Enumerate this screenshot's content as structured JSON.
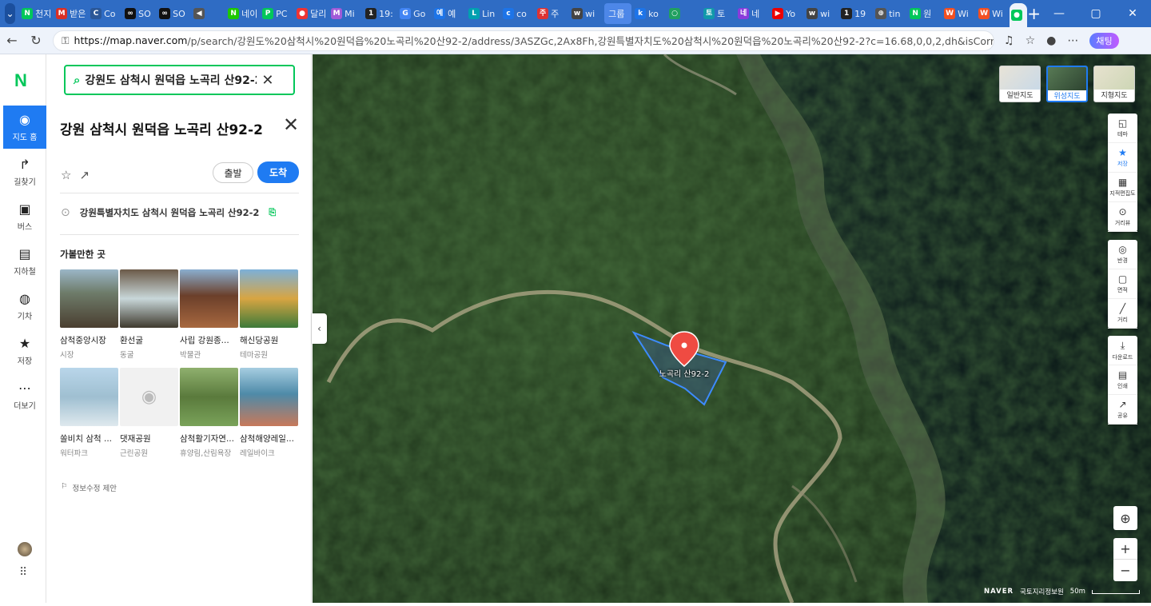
{
  "browser": {
    "tabs": [
      {
        "label": "천지",
        "color": "#03c75a",
        "g": "N"
      },
      {
        "label": "받은",
        "color": "#d93025",
        "g": "M"
      },
      {
        "label": "Co",
        "color": "#2b5797",
        "g": "C"
      },
      {
        "label": "SO",
        "color": "#111",
        "g": "∞"
      },
      {
        "label": "SO",
        "color": "#111",
        "g": "∞"
      },
      {
        "label": "",
        "color": "#555",
        "g": "◀"
      },
      {
        "label": "네이",
        "color": "#1ec800",
        "g": "N"
      },
      {
        "label": "PC",
        "color": "#03c75a",
        "g": "P"
      },
      {
        "label": "달리",
        "color": "#e33",
        "g": "●"
      },
      {
        "label": "Mi",
        "color": "#a15bd8",
        "g": "M"
      },
      {
        "label": "19:",
        "color": "#222",
        "g": "1"
      },
      {
        "label": "Go",
        "color": "#4285f4",
        "g": "G"
      },
      {
        "label": "예",
        "color": "#1d74e8",
        "g": "예"
      },
      {
        "label": "Lin",
        "color": "#00a0b0",
        "g": "L"
      },
      {
        "label": "co",
        "color": "#1d74e8",
        "g": "c"
      },
      {
        "label": "주",
        "color": "#d33",
        "g": "주"
      },
      {
        "label": "wi",
        "color": "#444",
        "g": "w"
      },
      {
        "label": "그룹",
        "color": "#4d87e8",
        "g": ""
      },
      {
        "label": "ko",
        "color": "#1d74e8",
        "g": "k"
      },
      {
        "label": "",
        "color": "#20a060",
        "g": "○"
      },
      {
        "label": "토",
        "color": "#19a",
        "g": "토"
      },
      {
        "label": "네",
        "color": "#8a3bdb",
        "g": "네"
      },
      {
        "label": "Yo",
        "color": "#e00",
        "g": "▶"
      },
      {
        "label": "wi",
        "color": "#444",
        "g": "w"
      },
      {
        "label": "19",
        "color": "#222",
        "g": "1"
      },
      {
        "label": "tin",
        "color": "#555",
        "g": "⊕"
      },
      {
        "label": "원",
        "color": "#03c75a",
        "g": "N"
      },
      {
        "label": "Wi",
        "color": "#f25022",
        "g": "W"
      },
      {
        "label": "Wi",
        "color": "#f25022",
        "g": "W"
      }
    ],
    "active_tab_close": "✕",
    "new_tab": "+",
    "url_host": "https://map.naver.com",
    "url_path": "/p/search/강원도%20삼척시%20원덕읍%20노곡리%20산92-2/address/3ASZGc,2Ax8Fh,강원특별자치도%20삼척시%20원덕읍%20노곡리%20산92-2?c=16.68,0,0,2,dh&isCorrectAnswer=t...",
    "chat_label": "채팅"
  },
  "rail": {
    "logo": "N",
    "items": [
      {
        "label": "지도 홈",
        "icon": "map-home"
      },
      {
        "label": "길찾기",
        "icon": "directions"
      },
      {
        "label": "버스",
        "icon": "bus"
      },
      {
        "label": "지하철",
        "icon": "subway"
      },
      {
        "label": "기차",
        "icon": "train"
      },
      {
        "label": "저장",
        "icon": "star"
      },
      {
        "label": "더보기",
        "icon": "more"
      }
    ]
  },
  "panel": {
    "search_value": "강원도 삼척시 원덕읍 노곡리 산92-2",
    "title": "강원 삼척시 원덕읍 노곡리 산92-2",
    "depart": "출발",
    "arrive": "도착",
    "address": "강원특별자치도 삼척시 원덕읍 노곡리 산92-2",
    "section": "가볼만한 곳",
    "places": [
      {
        "name": "삼척중앙시장",
        "cat": "시장"
      },
      {
        "name": "환선굴",
        "cat": "동굴"
      },
      {
        "name": "사립 강원종...",
        "cat": "박물관"
      },
      {
        "name": "해신당공원",
        "cat": "테마공원"
      },
      {
        "name": "쏠비치 삼척 ...",
        "cat": "워터파크"
      },
      {
        "name": "댓재공원",
        "cat": "근린공원"
      },
      {
        "name": "삼척활기자연...",
        "cat": "휴양림,산림욕장"
      },
      {
        "name": "삼척해양레일...",
        "cat": "레일바이크"
      }
    ],
    "suggest": "정보수정 제안"
  },
  "map": {
    "types": [
      "일반지도",
      "위성지도",
      "지형지도"
    ],
    "tools1": [
      "테마",
      "저장",
      "지적편집도",
      "거리뷰"
    ],
    "tools2": [
      "반경",
      "면적",
      "거리"
    ],
    "tools3": [
      "다운로드",
      "인쇄",
      "공유"
    ],
    "parcel_label": "노곡리 산92-2",
    "credit_brand": "NAVER",
    "credit_src": "국토지리정보원",
    "scale": "50m",
    "zoom_in": "+",
    "zoom_out": "−"
  }
}
